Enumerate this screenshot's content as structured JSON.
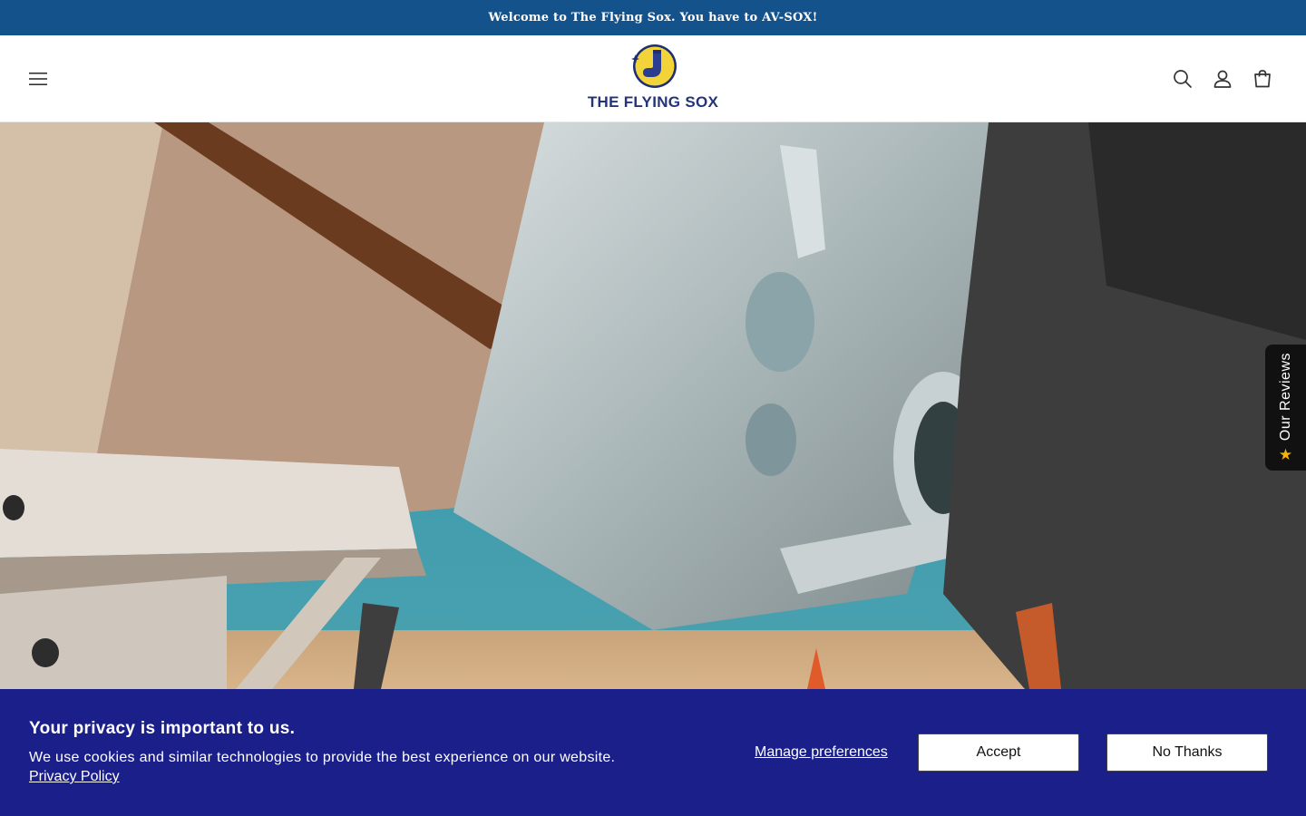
{
  "announcement": {
    "text": "Welcome to The Flying Sox. You have to AV-SOX!"
  },
  "header": {
    "brand": "THE FLYING SOX",
    "icons": [
      "menu-icon",
      "search-icon",
      "account-icon",
      "cart-icon"
    ]
  },
  "hero": {
    "image": "airplane-tarmac-photo"
  },
  "reviews_tab": {
    "label": "Our Reviews",
    "icon": "star-icon"
  },
  "cookie_banner": {
    "title": "Your privacy is important to us.",
    "text": "We use cookies and similar technologies to provide the best experience on our website.",
    "policy_link": "Privacy Policy",
    "manage_label": "Manage preferences",
    "accept_label": "Accept",
    "decline_label": "No Thanks"
  },
  "colors": {
    "announcement_bg": "#14528c",
    "cookie_bg": "#1b1f8a",
    "brand_text": "#24347a",
    "logo_yellow": "#f2d33a"
  }
}
